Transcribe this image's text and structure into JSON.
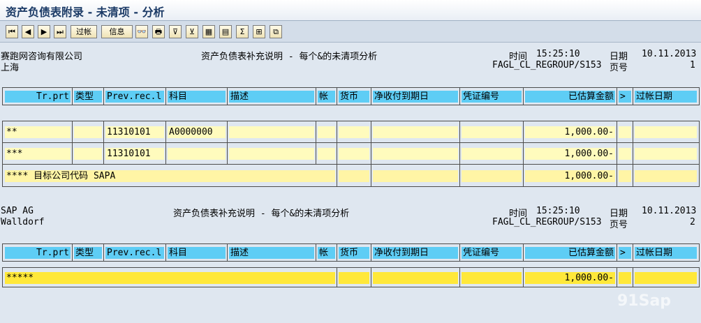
{
  "window": {
    "title": "资产负债表附录 - 未清项 - 分析"
  },
  "toolbar": {
    "buttons": [
      {
        "id": "first",
        "label": "⏮"
      },
      {
        "id": "prev",
        "label": "◀"
      },
      {
        "id": "next",
        "label": "▶"
      },
      {
        "id": "last",
        "label": "⏭"
      },
      {
        "id": "post",
        "label": "过帐"
      },
      {
        "id": "info",
        "label": "信息"
      },
      {
        "id": "glasses",
        "label": "👓"
      },
      {
        "id": "print",
        "label": "🖶"
      },
      {
        "id": "filter1",
        "label": "⊽"
      },
      {
        "id": "filter2",
        "label": "⊻"
      },
      {
        "id": "layout",
        "label": "▦"
      },
      {
        "id": "sheet",
        "label": "▤"
      },
      {
        "id": "sum",
        "label": "Σ"
      },
      {
        "id": "subtotal",
        "label": "⊞"
      },
      {
        "id": "export",
        "label": "⧉"
      }
    ]
  },
  "columns": [
    "Tr.prt",
    "类型",
    "Prev.rec.l",
    "科目",
    "描述",
    "帐",
    "货币",
    "净收付到期日",
    "凭证编号",
    "已估算金额",
    ">",
    "过帐日期"
  ],
  "page1": {
    "company": "赛跑网咨询有限公司",
    "city": "上海",
    "report_title": "资产负债表补充说明 - 每个&的未清项分析",
    "time_label": "时间",
    "time": "15:25:10",
    "date_label": "日期",
    "date": "10.11.2013",
    "program": "FAGL_CL_REGROUP/S153",
    "page_label": "页号",
    "page": "1",
    "rows": [
      {
        "trprt": "**",
        "prev": "11310101",
        "account": "A0000000",
        "amount": "1,000.00-"
      },
      {
        "trprt": "***",
        "prev": "11310101",
        "account": "",
        "amount": "1,000.00-"
      }
    ],
    "summary": {
      "text": "**** 目标公司代码 SAPA",
      "amount": "1,000.00-"
    }
  },
  "page2": {
    "company": "SAP AG",
    "city": "Walldorf",
    "report_title": "资产负债表补充说明 - 每个&的未清项分析",
    "time_label": "时间",
    "time": "15:25:10",
    "date_label": "日期",
    "date": "10.11.2013",
    "program": "FAGL_CL_REGROUP/S153",
    "page_label": "页号",
    "page": "2",
    "summary": {
      "text": "*****",
      "amount": "1,000.00-"
    }
  },
  "watermark": "91Sap"
}
